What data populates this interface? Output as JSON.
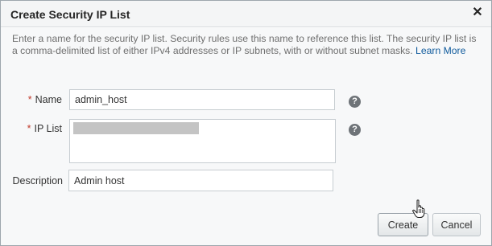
{
  "dialog": {
    "title": "Create Security IP List",
    "close_glyph": "✕",
    "description": "Enter a name for the security IP list. Security rules use this name to reference this list. The security IP list is a comma-delimited list of either IPv4 addresses or IP subnets, with or without subnet masks.",
    "learn_more": "Learn More"
  },
  "form": {
    "name": {
      "required_mark": "*",
      "label": "Name",
      "value": "admin_host"
    },
    "ip_list": {
      "required_mark": "*",
      "label": "IP List",
      "value": ""
    },
    "description": {
      "label": "Description",
      "value": "Admin host"
    },
    "help_glyph": "?"
  },
  "buttons": {
    "create": "Create",
    "cancel": "Cancel"
  },
  "icons": {
    "close": "close-icon",
    "help": "help-icon",
    "cursor": "hand-pointer-icon"
  }
}
